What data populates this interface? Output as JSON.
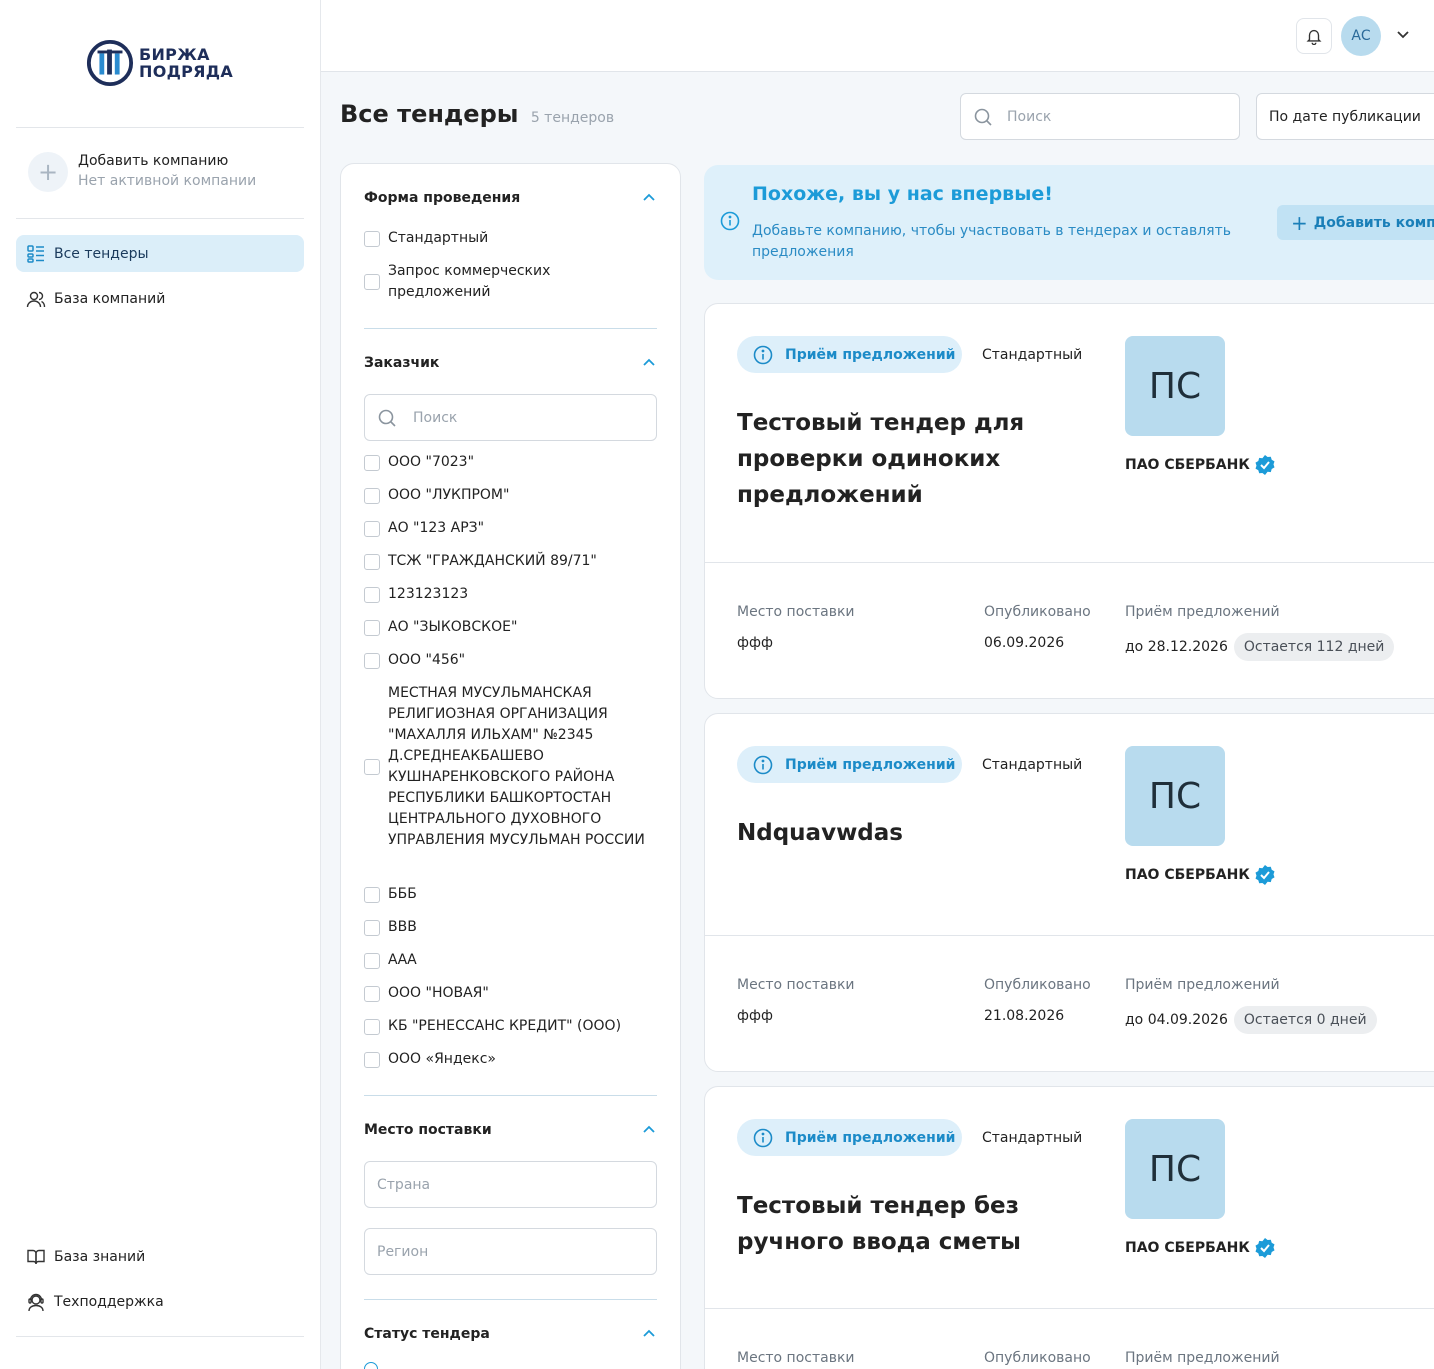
{
  "sidebar": {
    "logo_line1": "БИРЖА",
    "logo_line2": "ПОДРЯДА",
    "add_company_title": "Добавить компанию",
    "add_company_sub": "Нет активной компании",
    "nav": [
      {
        "label": "Все тендеры",
        "icon": "list-icon",
        "active": true
      },
      {
        "label": "База компаний",
        "icon": "users-icon",
        "active": false
      }
    ],
    "bottom_nav": [
      {
        "label": "База знаний",
        "icon": "book-icon"
      },
      {
        "label": "Техподдержка",
        "icon": "support-icon"
      }
    ]
  },
  "topbar": {
    "avatar_initials": "АС"
  },
  "page": {
    "title": "Все тендеры",
    "count": "5 тендеров",
    "search_placeholder": "Поиск",
    "sort_value": "По дате публикации"
  },
  "filters": {
    "form": {
      "title": "Форма проведения",
      "options": [
        "Стандартный",
        "Запрос коммерческих предложений"
      ]
    },
    "customer": {
      "title": "Заказчик",
      "search_placeholder": "Поиск",
      "options": [
        "ООО \"7023\"",
        "ООО \"ЛУКПРОМ\"",
        "АО \"123 АРЗ\"",
        "ТСЖ \"ГРАЖДАНСКИЙ 89/71\"",
        "123123123",
        "АО \"ЗЫКОВСКОЕ\"",
        "ООО \"456\"",
        "МЕСТНАЯ МУСУЛЬМАНСКАЯ РЕЛИГИОЗНАЯ ОРГАНИЗАЦИЯ \"МАХАЛЛЯ ИЛЬХАМ\" №2345 Д.СРЕДНЕАКБАШЕВО КУШНАРЕНКОВСКОГО РАЙОНА РЕСПУБЛИКИ БАШКОРТОСТАН ЦЕНТРАЛЬНОГО ДУХОВНОГО УПРАВЛЕНИЯ МУСУЛЬМАН РОССИИ",
        "БББ",
        "ВВВ",
        "ААА",
        "ООО \"НОВАЯ\"",
        "КБ \"РЕНЕССАНС КРЕДИТ\" (ООО)",
        "ООО «Яндекс»"
      ]
    },
    "place": {
      "title": "Место поставки",
      "country_placeholder": "Страна",
      "region_placeholder": "Регион"
    },
    "status": {
      "title": "Статус тендера"
    }
  },
  "banner": {
    "title": "Похоже, вы у нас впервые!",
    "text": "Добавьте компанию, чтобы участвовать в тендерах и оставлять предложения",
    "button": "Добавить компанию"
  },
  "labels": {
    "place": "Место поставки",
    "published": "Опубликовано",
    "offers": "Приём предложений"
  },
  "tenders": [
    {
      "status": "Приём предложений",
      "type": "Стандартный",
      "title": "Тестовый тендер для проверки одиноких предложений",
      "customer_initials": "ПС",
      "customer": "ПАО СБЕРБАНК",
      "place": "ффф",
      "published": "06.09.2026",
      "deadline": "до 28.12.2026",
      "remaining": "Остается 112 дней"
    },
    {
      "status": "Приём предложений",
      "type": "Стандартный",
      "title": "Ndquavwdas",
      "customer_initials": "ПС",
      "customer": "ПАО СБЕРБАНК",
      "place": "ффф",
      "published": "21.08.2026",
      "deadline": "до 04.09.2026",
      "remaining": "Остается 0 дней"
    },
    {
      "status": "Приём предложений",
      "type": "Стандартный",
      "title": "Тестовый тендер без ручного ввода сметы",
      "customer_initials": "ПС",
      "customer": "ПАО СБЕРБАНК"
    }
  ],
  "colors": {
    "accent": "#1c9bd8",
    "active_nav": "#dbeef9",
    "avatar": "#b8dbee"
  }
}
